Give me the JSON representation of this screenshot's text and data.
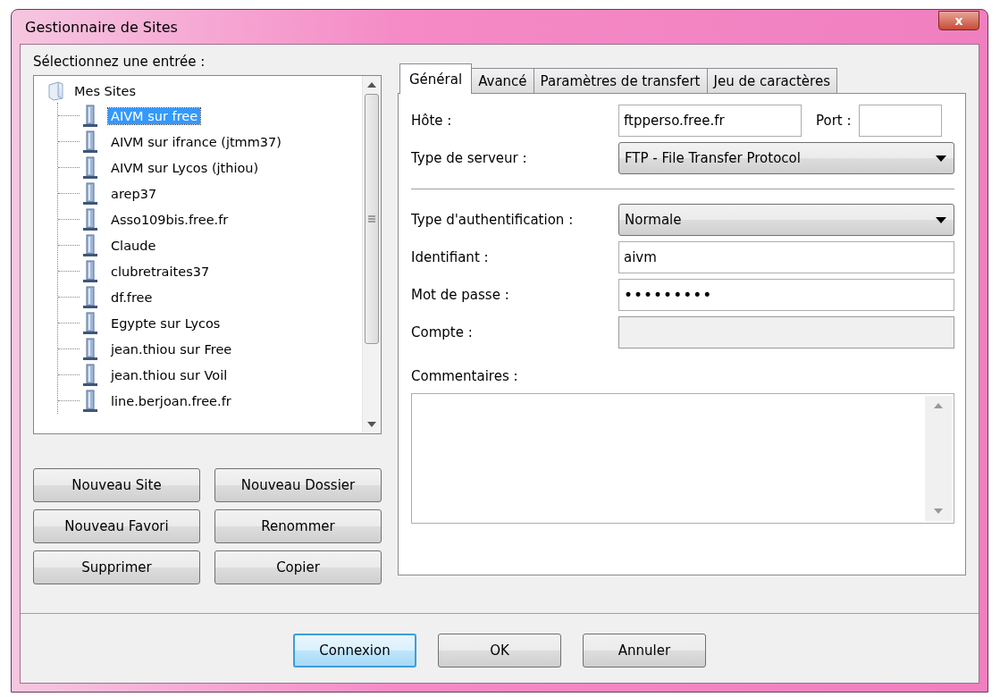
{
  "window": {
    "title": "Gestionnaire de Sites",
    "close": "x"
  },
  "site_tree": {
    "label": "Sélectionnez une entrée :",
    "root": {
      "label": "Mes Sites",
      "children": [
        {
          "label": "AIVM sur free",
          "selected": true
        },
        {
          "label": "AIVM sur ifrance (jtmm37)",
          "selected": false
        },
        {
          "label": "AIVM sur Lycos (jthiou)",
          "selected": false
        },
        {
          "label": "arep37",
          "selected": false
        },
        {
          "label": "Asso109bis.free.fr",
          "selected": false
        },
        {
          "label": "Claude",
          "selected": false
        },
        {
          "label": "clubretraites37",
          "selected": false
        },
        {
          "label": "df.free",
          "selected": false
        },
        {
          "label": "Egypte sur Lycos",
          "selected": false
        },
        {
          "label": "jean.thiou sur Free",
          "selected": false
        },
        {
          "label": "jean.thiou sur Voil",
          "selected": false
        },
        {
          "label": "line.berjoan.free.fr",
          "selected": false
        }
      ]
    }
  },
  "tree_buttons": [
    "Nouveau Site",
    "Nouveau Dossier",
    "Nouveau Favori",
    "Renommer",
    "Supprimer",
    "Copier"
  ],
  "tabs": [
    {
      "label": "Général",
      "selected": true
    },
    {
      "label": "Avancé",
      "selected": false
    },
    {
      "label": "Paramètres de transfert",
      "selected": false
    },
    {
      "label": "Jeu de caractères",
      "selected": false
    }
  ],
  "general": {
    "host": {
      "label": "Hôte :",
      "value": "ftpperso.free.fr"
    },
    "port": {
      "label": "Port :"
    },
    "server_type": {
      "label": "Type de serveur :",
      "value": "FTP - File Transfer Protocol"
    },
    "auth_type": {
      "label": "Type d'authentification :",
      "value": "Normale"
    },
    "fields": [
      {
        "label": "Identifiant :",
        "value": "aivm",
        "disabled": false
      },
      {
        "label": "Mot de passe :",
        "value": "•••••••••",
        "disabled": false,
        "kind": "password"
      },
      {
        "label": "Compte :",
        "disabled": true
      }
    ],
    "comments": {
      "label": "Commentaires :"
    }
  },
  "dialog_buttons": [
    {
      "label": "Connexion",
      "default": true
    },
    {
      "label": "OK",
      "default": false
    },
    {
      "label": "Annuler",
      "default": false
    }
  ]
}
